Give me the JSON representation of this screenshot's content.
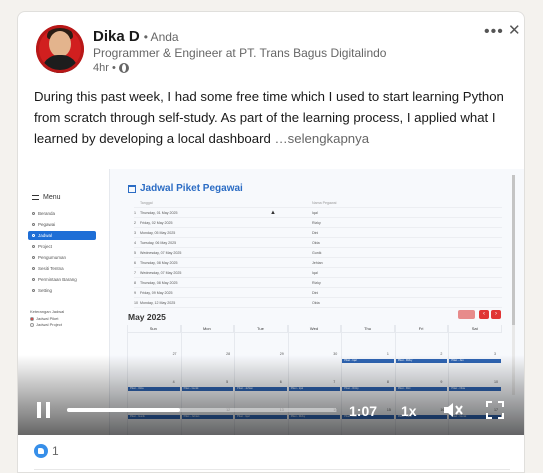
{
  "post": {
    "author": "Dika D",
    "you_label": "• Anda",
    "headline": "Programmer & Engineer at PT. Trans Bagus Digitalindo",
    "time": "4hr •",
    "more_label": "•••",
    "close_label": "✕",
    "text": "During this past week, I had some free time which I used to start learning Python from scratch through self-study. As part of the learning process, I applied what I learned by developing a local dashboard ",
    "see_more": "…selengkapnya"
  },
  "video": {
    "elapsed": "1:07",
    "speed": "1x",
    "progress": 0.42,
    "muted": true,
    "dashboard": {
      "menu_title": "Menu",
      "sidebar": [
        "Beranda",
        "Pegawai",
        "Jadwal",
        "Project",
        "Pengumuman",
        "Sesiti Tentna",
        "Permintaan Barang",
        "Setting"
      ],
      "active_index": 2,
      "legend_title": "Keterangan Jadwal",
      "legend": [
        {
          "label": "Jadwal Piket",
          "color": "#e03535"
        },
        {
          "label": "Jadwal Project",
          "color": "#ffffff"
        }
      ],
      "page_title": "Jadwal Piket Pegawai",
      "table_headers": [
        "Tanggal",
        "Nama Pegawai"
      ],
      "table_rows": [
        [
          "Thursday, 01 May 2025",
          "Iqal"
        ],
        [
          "Friday, 02 May 2025",
          "Rizky"
        ],
        [
          "Monday, 05 May 2025",
          "Dini"
        ],
        [
          "Tuesday, 06 May 2025",
          "Okta"
        ],
        [
          "Wednesday, 07 May 2025",
          "Gunik"
        ],
        [
          "Thursday, 08 May 2025",
          "Jehian"
        ],
        [
          "Wednesday, 07 May 2025",
          "Iqal"
        ],
        [
          "Thursday, 08 May 2025",
          "Rizky"
        ],
        [
          "Friday, 09 May 2025",
          "Dini"
        ],
        [
          "Monday, 12 May 2025",
          "Okta"
        ]
      ],
      "month": "May 2025",
      "nav_prev": "‹",
      "nav_next": "›",
      "weekdays": [
        "Sun",
        "Mon",
        "Tue",
        "Wed",
        "Thu",
        "Fri",
        "Sat"
      ],
      "week_rows": [
        [
          "27",
          "28",
          "29",
          "30",
          "1",
          "2",
          "3"
        ],
        [
          "4",
          "5",
          "6",
          "7",
          "8",
          "9",
          "10"
        ],
        [
          "11",
          "12",
          "13",
          "14",
          "15",
          "16",
          "17"
        ]
      ],
      "events": [
        [
          null,
          null,
          null,
          null,
          "Piket - Iqal",
          "Piket - Rizky",
          "Piket - Jun"
        ],
        [
          "Piket - Okta",
          "Piket - Gunik",
          "Piket - Jehian",
          "Piket - Iqal",
          "Piket - Rizky",
          "Piket - Dini",
          "Piket - Okta"
        ],
        [
          "Piket - Gunik",
          "Piket - Jehian",
          "Piket - Iqal",
          "Piket - Rizky",
          "Piket - Dini",
          "Piket - Okta",
          "Piket - Gunik"
        ]
      ]
    }
  },
  "reactions": {
    "count": "1"
  },
  "colors": {
    "accent": "#1e6ed6",
    "event": "#2f66b5",
    "nav_red": "#e03535"
  }
}
